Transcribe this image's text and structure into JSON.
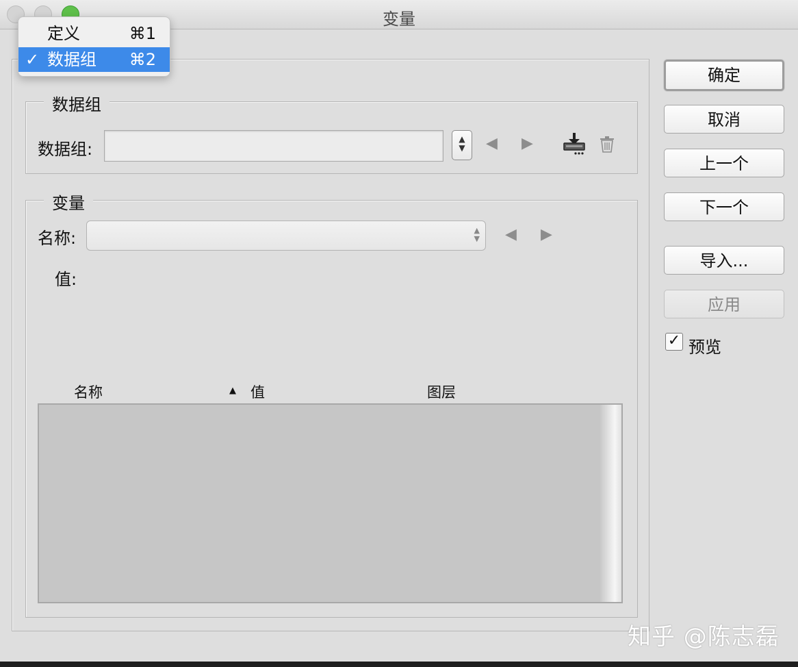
{
  "window": {
    "title": "变量"
  },
  "menu": {
    "items": [
      {
        "label": "定义",
        "shortcut": "⌘1",
        "checked": false,
        "check_mark": ""
      },
      {
        "label": "数据组",
        "shortcut": "⌘2",
        "checked": true,
        "check_mark": "✓"
      }
    ]
  },
  "dataset_group": {
    "title": "数据组",
    "field_label": "数据组:",
    "field_value": ""
  },
  "variable_group": {
    "title": "变量",
    "name_label": "名称:",
    "name_value": "",
    "value_label": "值:"
  },
  "table": {
    "columns": [
      "名称",
      "值",
      "图层"
    ],
    "sort_indicator": "▲",
    "rows": []
  },
  "buttons": {
    "ok": "确定",
    "cancel": "取消",
    "previous": "上一个",
    "next": "下一个",
    "import": "导入...",
    "apply": "应用"
  },
  "preview": {
    "label": "预览",
    "checked": true,
    "check_mark": "✓"
  },
  "watermark": "知乎 @陈志磊",
  "icons": {
    "dataset_stepper": "up-down-stepper-icon",
    "prev": "left-arrow-icon",
    "next": "right-arrow-icon",
    "import": "import-tray-icon",
    "delete": "trash-icon"
  },
  "colors": {
    "accent": "#3d8ae9",
    "close_green": "#5fc04b"
  }
}
